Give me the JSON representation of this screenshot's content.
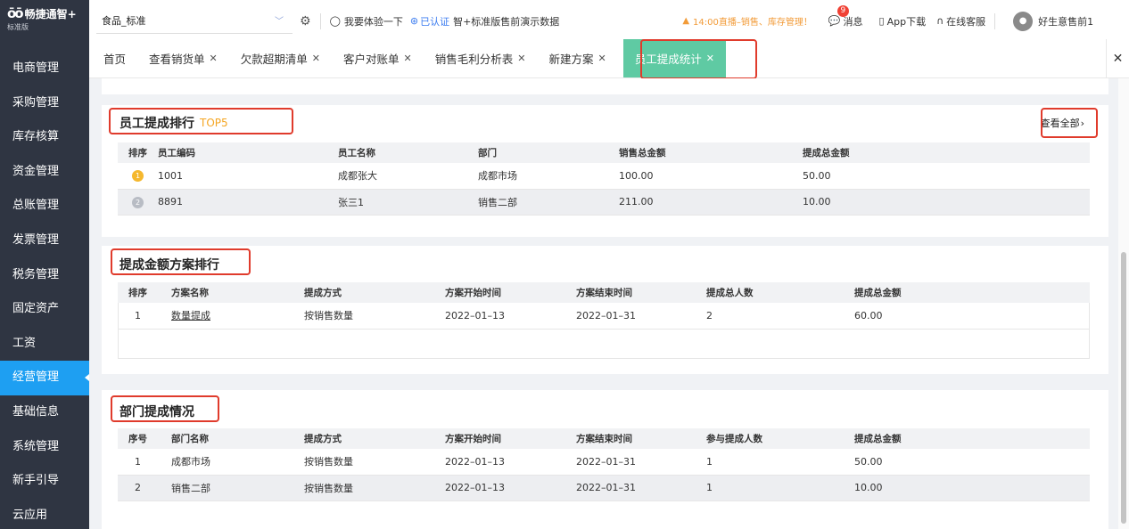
{
  "app": {
    "name": "畅捷通智+",
    "edition": "标准版"
  },
  "sidebar": {
    "items": [
      {
        "label": "电商管理"
      },
      {
        "label": "采购管理"
      },
      {
        "label": "库存核算"
      },
      {
        "label": "资金管理"
      },
      {
        "label": "总账管理"
      },
      {
        "label": "发票管理"
      },
      {
        "label": "税务管理"
      },
      {
        "label": "固定资产"
      },
      {
        "label": "工资"
      },
      {
        "label": "经营管理"
      },
      {
        "label": "基础信息"
      },
      {
        "label": "系统管理"
      },
      {
        "label": "新手引导"
      },
      {
        "label": "云应用"
      }
    ],
    "active_index": 9
  },
  "header": {
    "account": "食品_标准",
    "try_label": "我要体验一下",
    "cert_label": "已认证",
    "demo_label": "智+标准版售前演示数据",
    "live_label": "14:00直播–销售、库存管理！",
    "message_label": "消息",
    "message_count": "9",
    "app_download": "App下载",
    "online_service": "在线客服",
    "username": "好生意售前1"
  },
  "tabs": [
    {
      "label": "首页",
      "closable": false
    },
    {
      "label": "查看销货单",
      "closable": true
    },
    {
      "label": "欠款超期清单",
      "closable": true
    },
    {
      "label": "客户对账单",
      "closable": true
    },
    {
      "label": "销售毛利分析表",
      "closable": true
    },
    {
      "label": "新建方案",
      "closable": true
    },
    {
      "label": "员工提成统计",
      "closable": true,
      "active": true
    }
  ],
  "employee_ranking": {
    "title": "员工提成排行",
    "badge": "TOP5",
    "view_all": "查看全部",
    "columns": [
      "排序",
      "员工编码",
      "员工名称",
      "部门",
      "销售总金额",
      "提成总金额"
    ],
    "rows": [
      {
        "rank": 1,
        "code": "1001",
        "name": "成都张大",
        "dept": "成都市场",
        "sales": "100.00",
        "commission": "50.00"
      },
      {
        "rank": 2,
        "code": "8891",
        "name": "张三1",
        "dept": "销售二部",
        "sales": "211.00",
        "commission": "10.00"
      }
    ]
  },
  "plan_ranking": {
    "title": "提成金额方案排行",
    "columns": [
      "排序",
      "方案名称",
      "提成方式",
      "方案开始时间",
      "方案结束时间",
      "提成总人数",
      "提成总金额"
    ],
    "rows": [
      {
        "rank": "1",
        "name": "数量提成",
        "method": "按销售数量",
        "start": "2022–01–13",
        "end": "2022–01–31",
        "people": "2",
        "amount": "60.00"
      }
    ]
  },
  "dept_status": {
    "title": "部门提成情况",
    "columns": [
      "序号",
      "部门名称",
      "提成方式",
      "方案开始时间",
      "方案结束时间",
      "参与提成人数",
      "提成总金额"
    ],
    "rows": [
      {
        "no": "1",
        "name": "成都市场",
        "method": "按销售数量",
        "start": "2022–01–13",
        "end": "2022–01–31",
        "people": "1",
        "amount": "50.00"
      },
      {
        "no": "2",
        "name": "销售二部",
        "method": "按销售数量",
        "start": "2022–01–13",
        "end": "2022–01–31",
        "people": "1",
        "amount": "10.00"
      }
    ]
  },
  "colors": {
    "sidebar_bg": "#2f3542",
    "sidebar_active": "#1e9ff2",
    "tab_active": "#5fcaa3",
    "highlight_box": "#e03b2c",
    "top5": "#f5a623"
  }
}
